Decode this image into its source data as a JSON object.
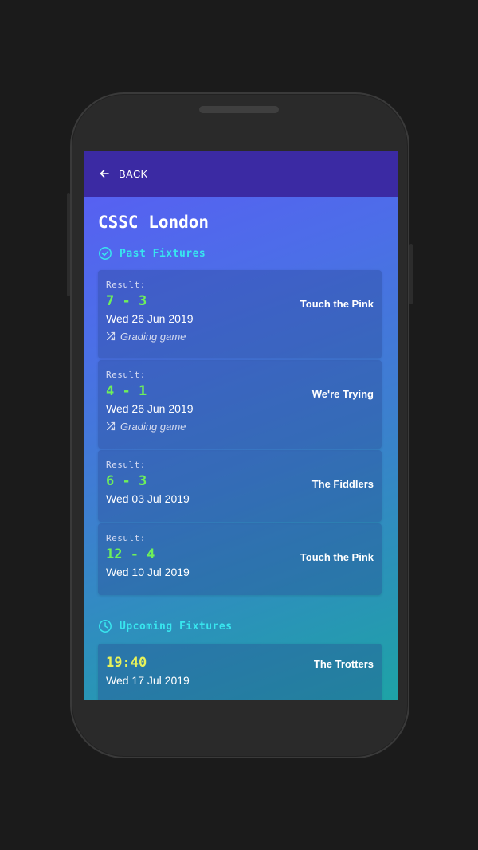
{
  "appbar": {
    "back_label": "BACK",
    "back_icon": "arrow-left-icon"
  },
  "page": {
    "title": "CSSC London"
  },
  "past_fixtures": {
    "header": "Past Fixtures",
    "icon": "check-circle-icon",
    "result_label": "Result:",
    "items": [
      {
        "score": "7 - 3",
        "opponent": "Touch the Pink",
        "date": "Wed 26 Jun 2019",
        "note": "Grading game"
      },
      {
        "score": "4 - 1",
        "opponent": "We're Trying",
        "date": "Wed 26 Jun 2019",
        "note": "Grading game"
      },
      {
        "score": "6 - 3",
        "opponent": "The Fiddlers",
        "date": "Wed 03 Jul 2019"
      },
      {
        "score": "12 - 4",
        "opponent": "Touch the Pink",
        "date": "Wed 10 Jul 2019"
      }
    ]
  },
  "upcoming_fixtures": {
    "header": "Upcoming Fixtures",
    "icon": "clock-icon",
    "items": [
      {
        "time": "19:40",
        "opponent": "The Trotters",
        "date": "Wed 17 Jul 2019"
      }
    ]
  },
  "colors": {
    "appbar": "#3b2aa3",
    "accent_cyan": "#38e6ef",
    "score_green": "#6ef05a",
    "time_yellow": "#e8f25a"
  }
}
